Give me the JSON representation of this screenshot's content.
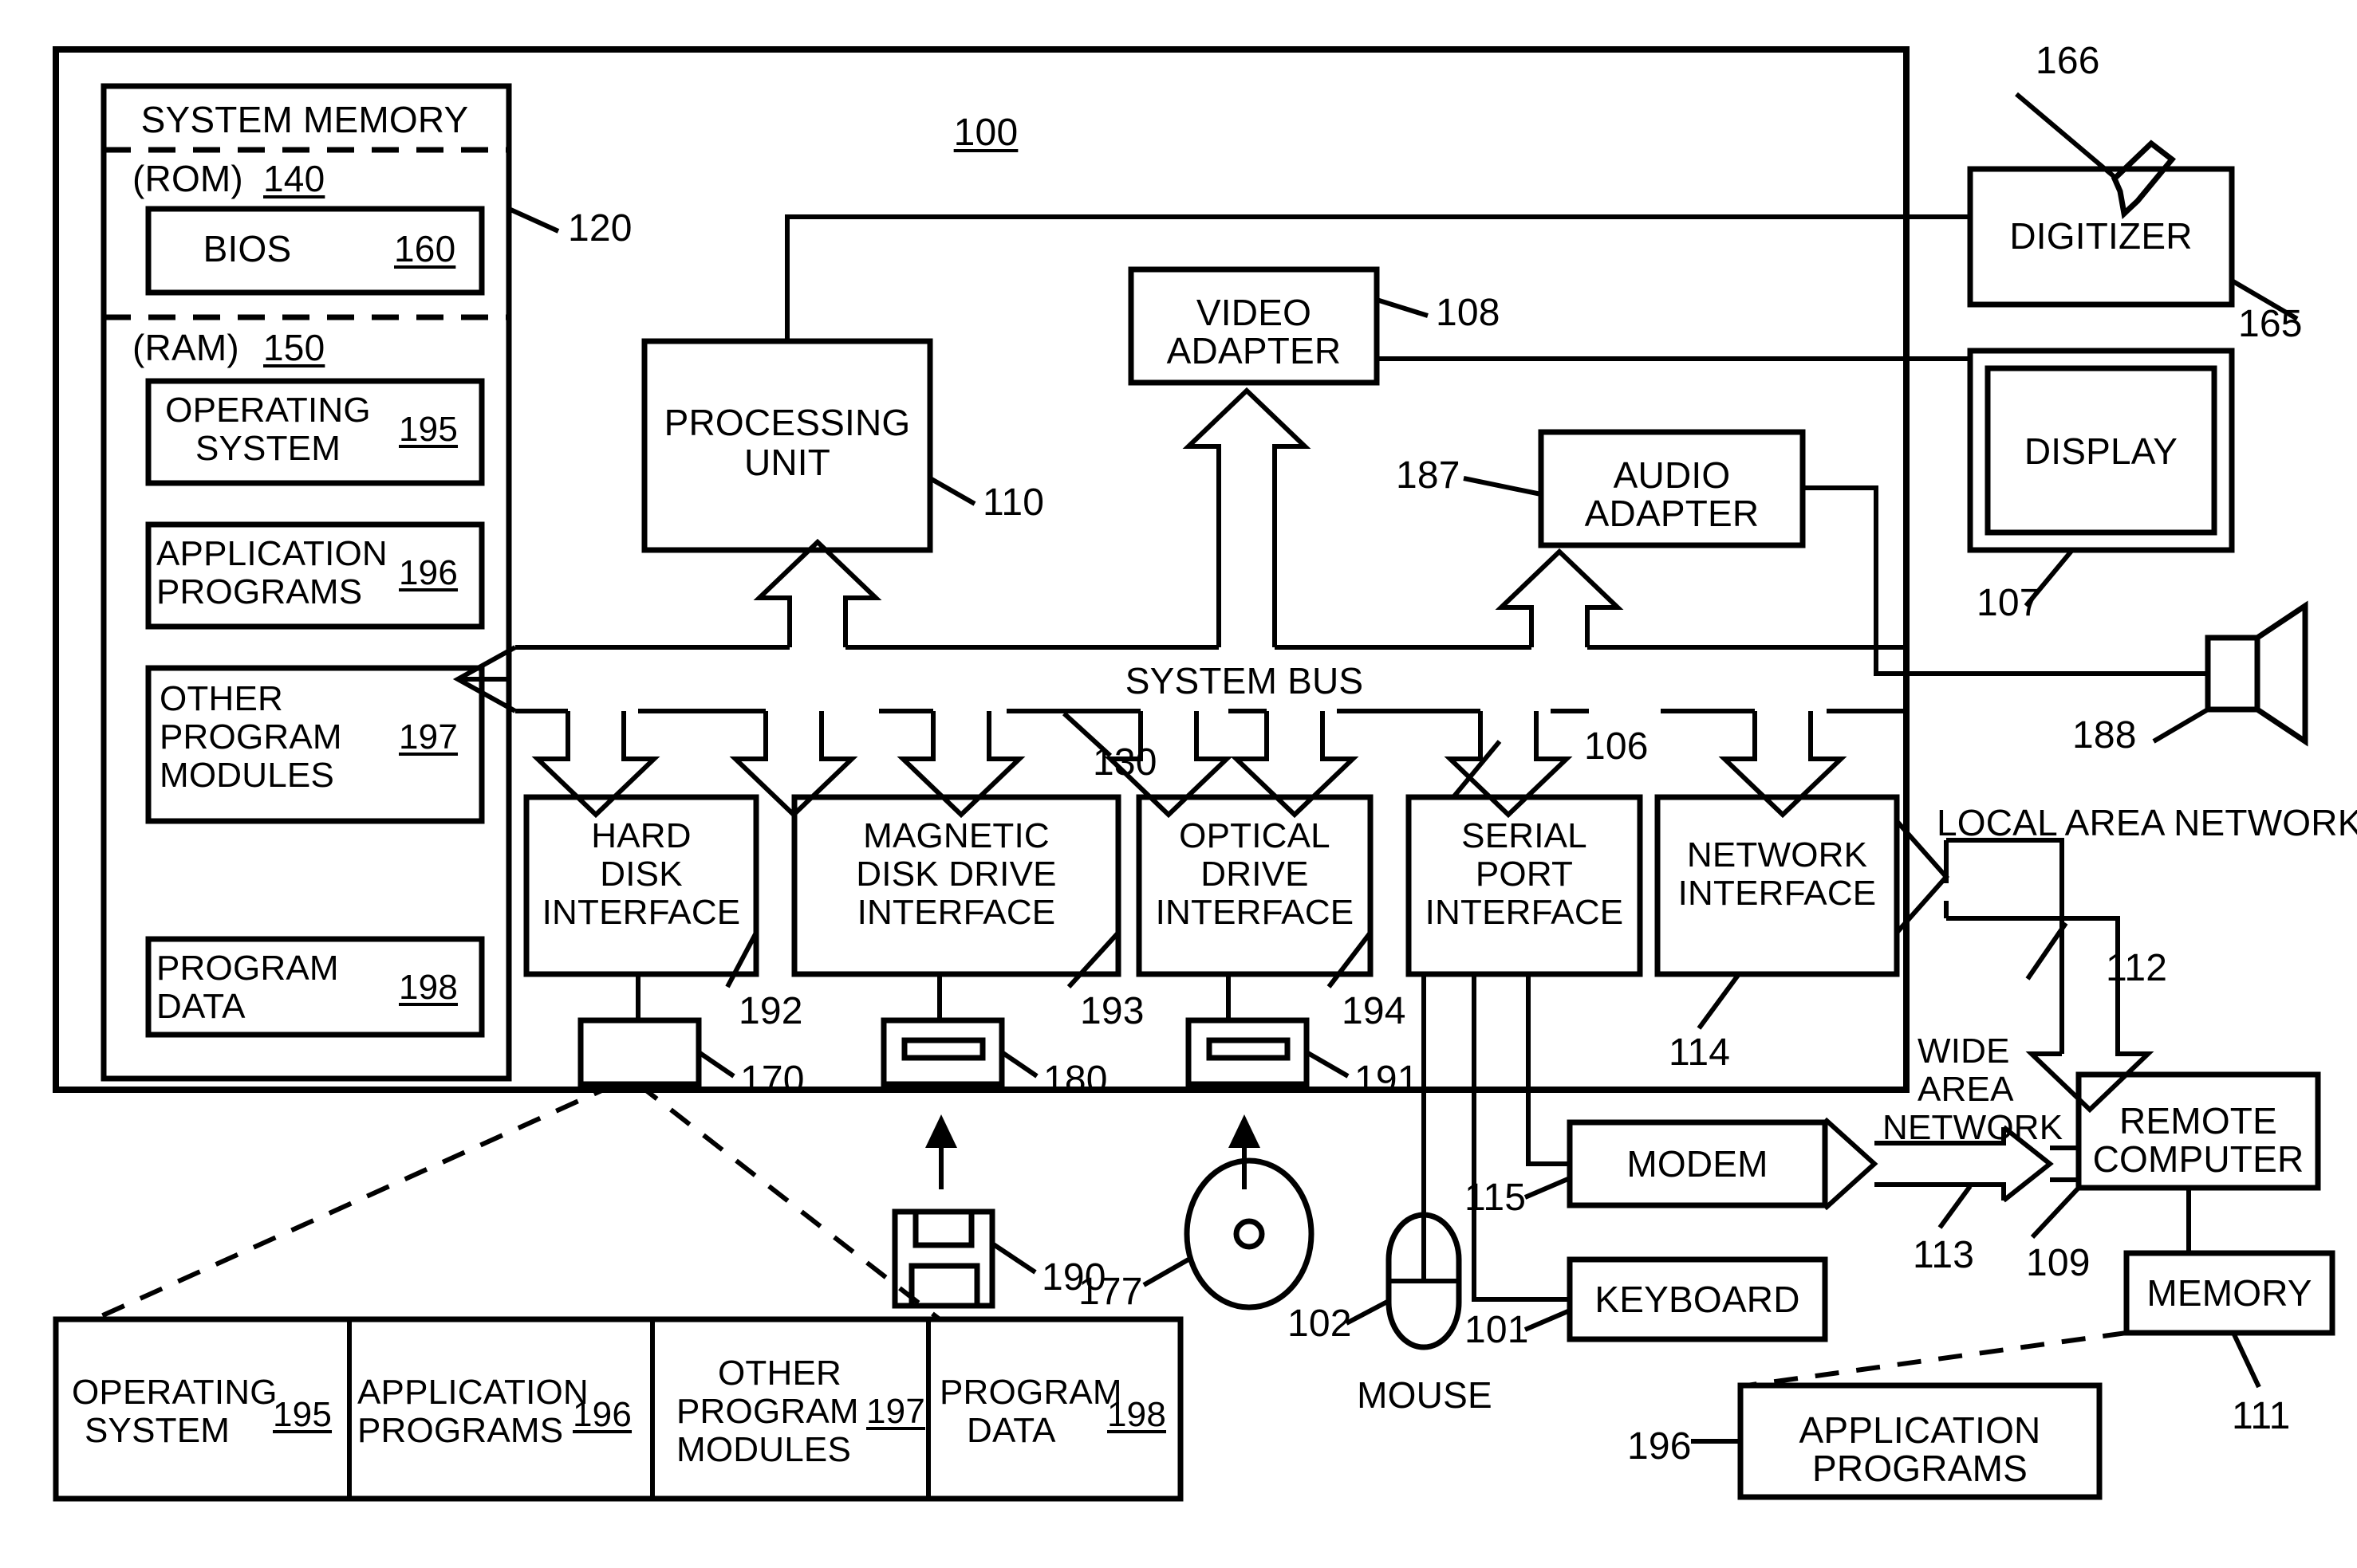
{
  "figure": {
    "title_ref": "100",
    "system_memory": {
      "heading": "SYSTEM MEMORY",
      "outer_ref": "120",
      "rom_label": "(ROM)",
      "rom_ref": "140",
      "bios_label": "BIOS",
      "bios_ref": "160",
      "ram_label": "(RAM)",
      "ram_ref": "150",
      "ram_blocks": [
        {
          "label_line1": "OPERATING",
          "label_line2": "SYSTEM",
          "ref": "195"
        },
        {
          "label_line1": "APPLICATION",
          "label_line2": "PROGRAMS",
          "ref": "196"
        },
        {
          "label_line1": "OTHER",
          "label_line2": "PROGRAM",
          "label_line3": "MODULES",
          "ref": "197"
        },
        {
          "label_line1": "PROGRAM",
          "label_line2": "DATA",
          "ref": "198"
        }
      ]
    },
    "processing_unit": {
      "line1": "PROCESSING",
      "line2": "UNIT",
      "ref": "110"
    },
    "video_adapter": {
      "line1": "VIDEO",
      "line2": "ADAPTER",
      "ref": "108"
    },
    "audio_adapter": {
      "line1": "AUDIO",
      "line2": "ADAPTER",
      "ref": "187"
    },
    "digitizer": {
      "label": "DIGITIZER",
      "ref": "165",
      "stylus_ref": "166"
    },
    "display": {
      "label": "DISPLAY",
      "ref": "107"
    },
    "speaker": {
      "ref": "188"
    },
    "system_bus": {
      "label": "SYSTEM BUS",
      "ref": "130"
    },
    "serial_port_ref": "106",
    "interfaces": [
      {
        "line1": "HARD",
        "line2": "DISK",
        "line3": "INTERFACE",
        "ref": "192"
      },
      {
        "line1": "MAGNETIC",
        "line2": "DISK DRIVE",
        "line3": "INTERFACE",
        "ref": "193"
      },
      {
        "line1": "OPTICAL",
        "line2": "DRIVE",
        "line3": "INTERFACE",
        "ref": "194"
      },
      {
        "line1": "SERIAL",
        "line2": "PORT",
        "line3": "INTERFACE",
        "ref": null
      },
      {
        "line1": "NETWORK",
        "line2": "INTERFACE",
        "line3": "",
        "ref": "114"
      }
    ],
    "drives": [
      {
        "name": "hard-disk-drive",
        "ref": "170"
      },
      {
        "name": "magnetic-disk-drive",
        "ref": "180"
      },
      {
        "name": "optical-disk-drive",
        "ref": "191"
      }
    ],
    "media": [
      {
        "name": "floppy-disk",
        "ref": "190"
      },
      {
        "name": "optical-disc",
        "ref": "177"
      }
    ],
    "mouse": {
      "label": "MOUSE",
      "ref": "102"
    },
    "keyboard": {
      "label": "KEYBOARD",
      "ref": "101"
    },
    "modem": {
      "label": "MODEM",
      "ref": "115"
    },
    "lan_label": "LOCAL AREA NETWORK",
    "lan_ref": "112",
    "wan_label_line1": "WIDE",
    "wan_label_line2": "AREA",
    "wan_label_line3": "NETWORK",
    "wan_ref": "113",
    "remote_computer": {
      "line1": "REMOTE",
      "line2": "COMPUTER",
      "ref": "109"
    },
    "remote_memory": {
      "label": "MEMORY",
      "ref": "111"
    },
    "remote_apps": {
      "line1": "APPLICATION",
      "line2": "PROGRAMS",
      "ref": "196"
    },
    "expanded_bar": [
      {
        "line1": "OPERATING",
        "line2": "SYSTEM",
        "ref": "195"
      },
      {
        "line1": "APPLICATION",
        "line2": "PROGRAMS",
        "ref": "196"
      },
      {
        "line1": "OTHER",
        "line2": "PROGRAM",
        "line3": "MODULES",
        "ref": "197"
      },
      {
        "line1": "PROGRAM",
        "line2": "DATA",
        "ref": "198"
      }
    ]
  },
  "colors": {
    "ink": "#000000",
    "paper": "#ffffff"
  }
}
